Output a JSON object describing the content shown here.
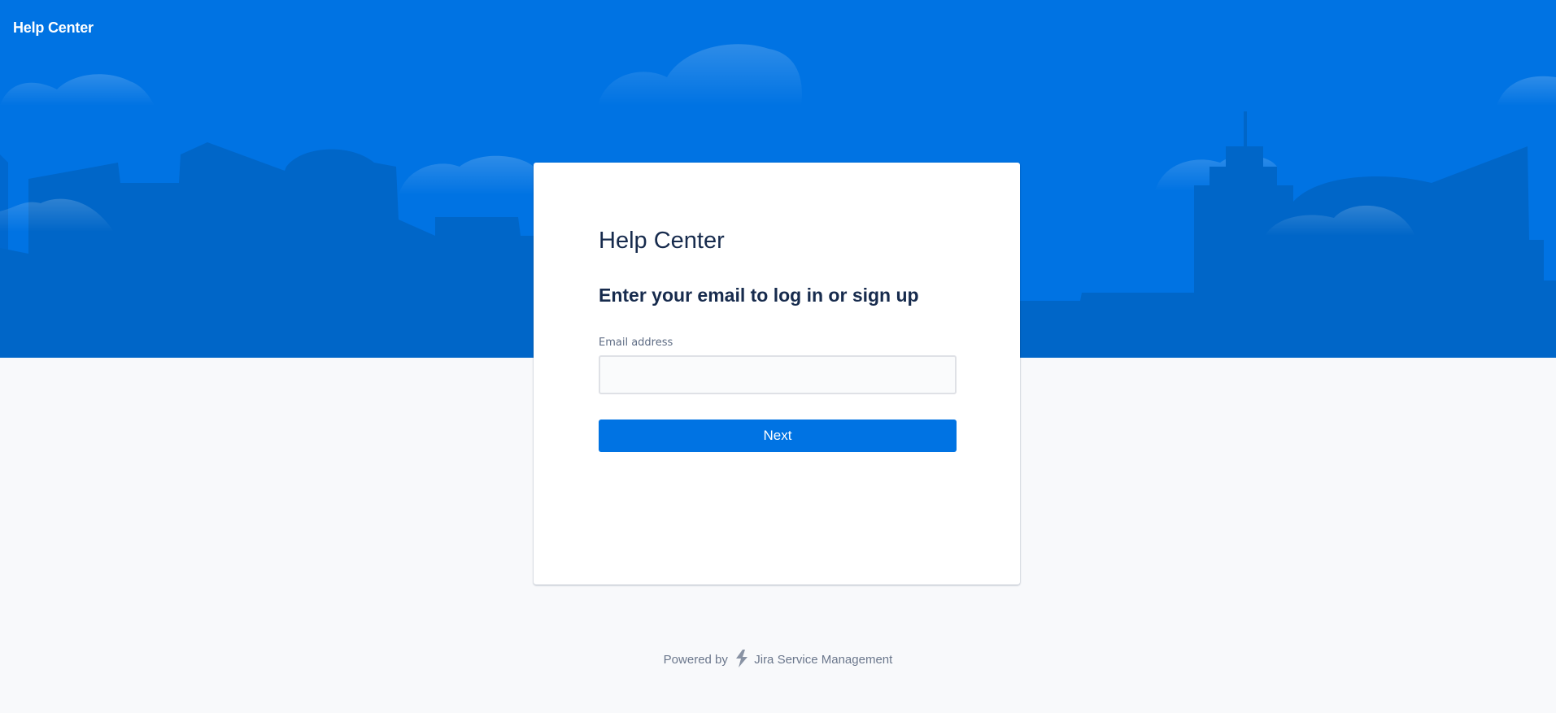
{
  "header": {
    "title": "Help Center"
  },
  "login_card": {
    "title": "Help Center",
    "subtitle": "Enter your email to log in or sign up",
    "email_label": "Email address",
    "email_value": "",
    "email_placeholder": "",
    "next_label": "Next"
  },
  "footer": {
    "powered_by": "Powered by",
    "product_name": "Jira Service Management",
    "product_icon": "jira-service-management-bolt-icon"
  },
  "colors": {
    "banner_blue": "#0073e3",
    "skyline_dark": "#0066c8",
    "button_blue": "#0073e3",
    "page_background": "#f8f9fb",
    "text_dark": "#172b4d",
    "text_muted": "#6b778c"
  }
}
